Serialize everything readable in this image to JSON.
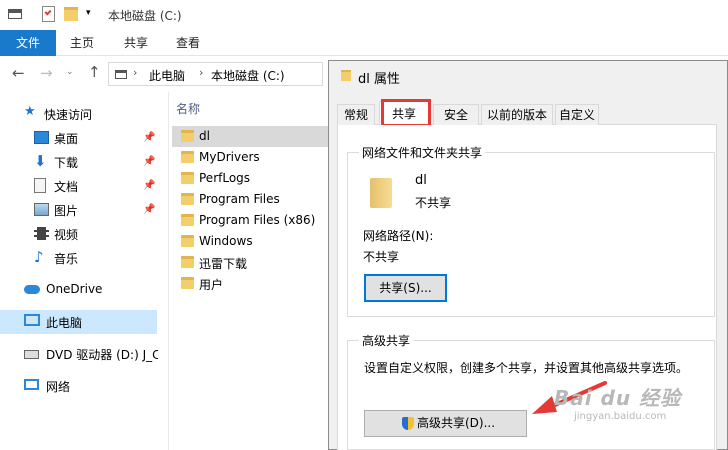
{
  "explorer": {
    "qat_title": "本地磁盘 (C:)",
    "ribbon_tabs": [
      "文件",
      "主页",
      "共享",
      "查看"
    ],
    "breadcrumb": [
      "此电脑",
      "本地磁盘 (C:)"
    ],
    "nav": {
      "quick_access": "快速访问",
      "items": [
        "桌面",
        "下载",
        "文档",
        "图片",
        "视频",
        "音乐"
      ],
      "onedrive": "OneDrive",
      "this_pc": "此电脑",
      "dvd": "DVD 驱动器 (D:) J_C",
      "network": "网络"
    },
    "content": {
      "column_name": "名称",
      "files": [
        "dl",
        "MyDrivers",
        "PerfLogs",
        "Program Files",
        "Program Files (x86)",
        "Windows",
        "迅雷下载",
        "用户"
      ]
    }
  },
  "dialog": {
    "title": "dl 属性",
    "tabs": [
      "常规",
      "共享",
      "安全",
      "以前的版本",
      "自定义"
    ],
    "active_tab": "共享",
    "network_group": {
      "title": "网络文件和文件夹共享",
      "folder_name": "dl",
      "folder_status": "不共享",
      "path_label": "网络路径(N):",
      "path_value": "不共享",
      "share_button": "共享(S)..."
    },
    "advanced_group": {
      "title": "高级共享",
      "description": "设置自定义权限，创建多个共享，并设置其他高级共享选项。",
      "button": "高级共享(D)..."
    }
  },
  "watermark": {
    "brand": "Bai du 经验",
    "url": "jingyan.baidu.com"
  },
  "colors": {
    "accent": "#1979ca",
    "highlight_red": "#e53935",
    "selection": "#cce8ff"
  }
}
